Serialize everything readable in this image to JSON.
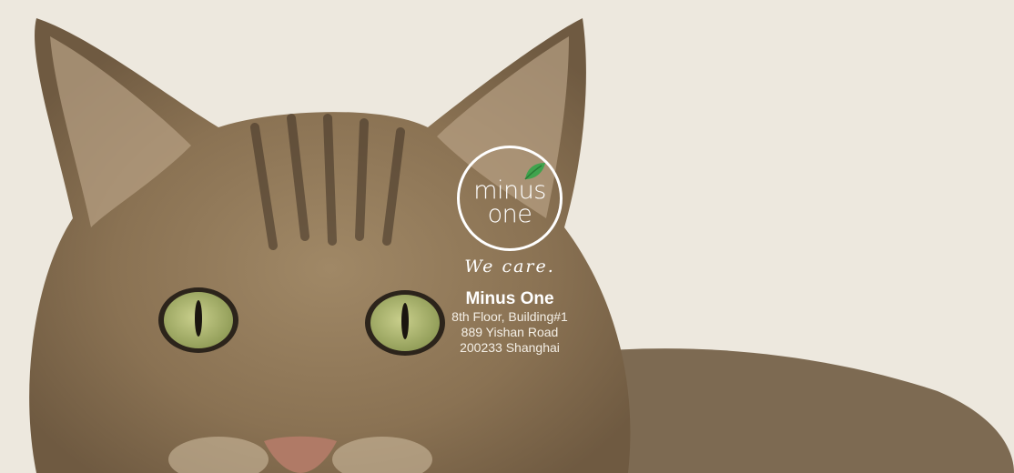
{
  "logo": {
    "word_top": "minus",
    "word_bottom": "one",
    "icon": "leaf-icon",
    "leaf_color": "#3fa34d"
  },
  "tagline": "We care.",
  "company": {
    "name": "Minus One",
    "address": [
      "8th Floor, Building#1",
      "889 Yishan Road",
      "200233 Shanghai"
    ]
  },
  "colors": {
    "background": "#ede8de",
    "text": "#ffffff"
  }
}
